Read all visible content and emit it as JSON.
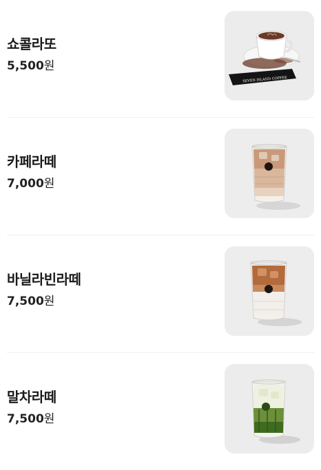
{
  "menu": {
    "items": [
      {
        "name": "쇼콜라또",
        "price": "5,500",
        "unit": "원",
        "image": "chocolatte-cup-photo",
        "image_caption": "SEVEN ISLAND COFFEE"
      },
      {
        "name": "카페라떼",
        "price": "7,000",
        "unit": "원",
        "image": "iced-cafe-latte-photo"
      },
      {
        "name": "바닐라빈라떼",
        "price": "7,500",
        "unit": "원",
        "image": "iced-vanilla-bean-latte-photo"
      },
      {
        "name": "말차라떼",
        "price": "7,500",
        "unit": "원",
        "image": "iced-matcha-latte-photo"
      }
    ]
  }
}
